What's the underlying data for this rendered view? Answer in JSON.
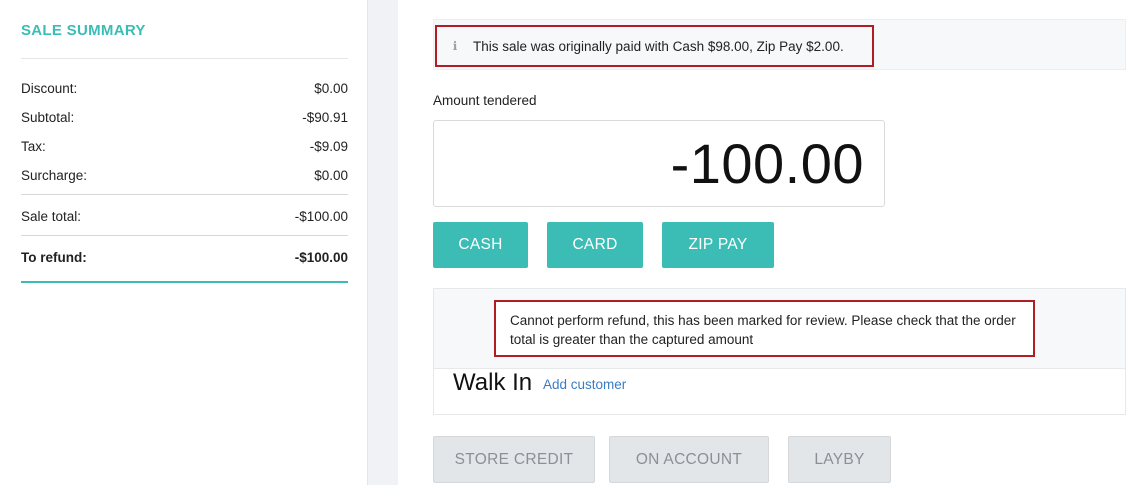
{
  "summary": {
    "title": "SALE SUMMARY",
    "rows": [
      {
        "label": "Discount:",
        "value": "$0.00"
      },
      {
        "label": "Subtotal:",
        "value": "-$90.91"
      },
      {
        "label": "Tax:",
        "value": "-$9.09"
      },
      {
        "label": "Surcharge:",
        "value": "$0.00"
      }
    ],
    "sale_total": {
      "label": "Sale total:",
      "value": "-$100.00"
    },
    "to_refund": {
      "label": "To refund:",
      "value": "-$100.00"
    }
  },
  "info": {
    "icon": "info-icon",
    "glyph": "ℹ",
    "message": "This sale was originally paid with Cash $98.00, Zip Pay $2.00."
  },
  "tender": {
    "label": "Amount tendered",
    "amount": "-100.00"
  },
  "payment_buttons": {
    "cash": "CASH",
    "card": "CARD",
    "zip_pay": "ZIP PAY"
  },
  "error": {
    "message": "Cannot perform refund, this has been marked for review. Please check that the order total is greater than the captured amount"
  },
  "customer": {
    "name": "Walk In",
    "add_link": "Add customer"
  },
  "alt_buttons": {
    "store_credit": "STORE CREDIT",
    "on_account": "ON ACCOUNT",
    "layby": "LAYBY"
  },
  "colors": {
    "accent": "#3bbdb6",
    "highlight_border": "#b01d24",
    "link": "#3a7cc4",
    "disabled_bg": "#e3e6e9"
  }
}
